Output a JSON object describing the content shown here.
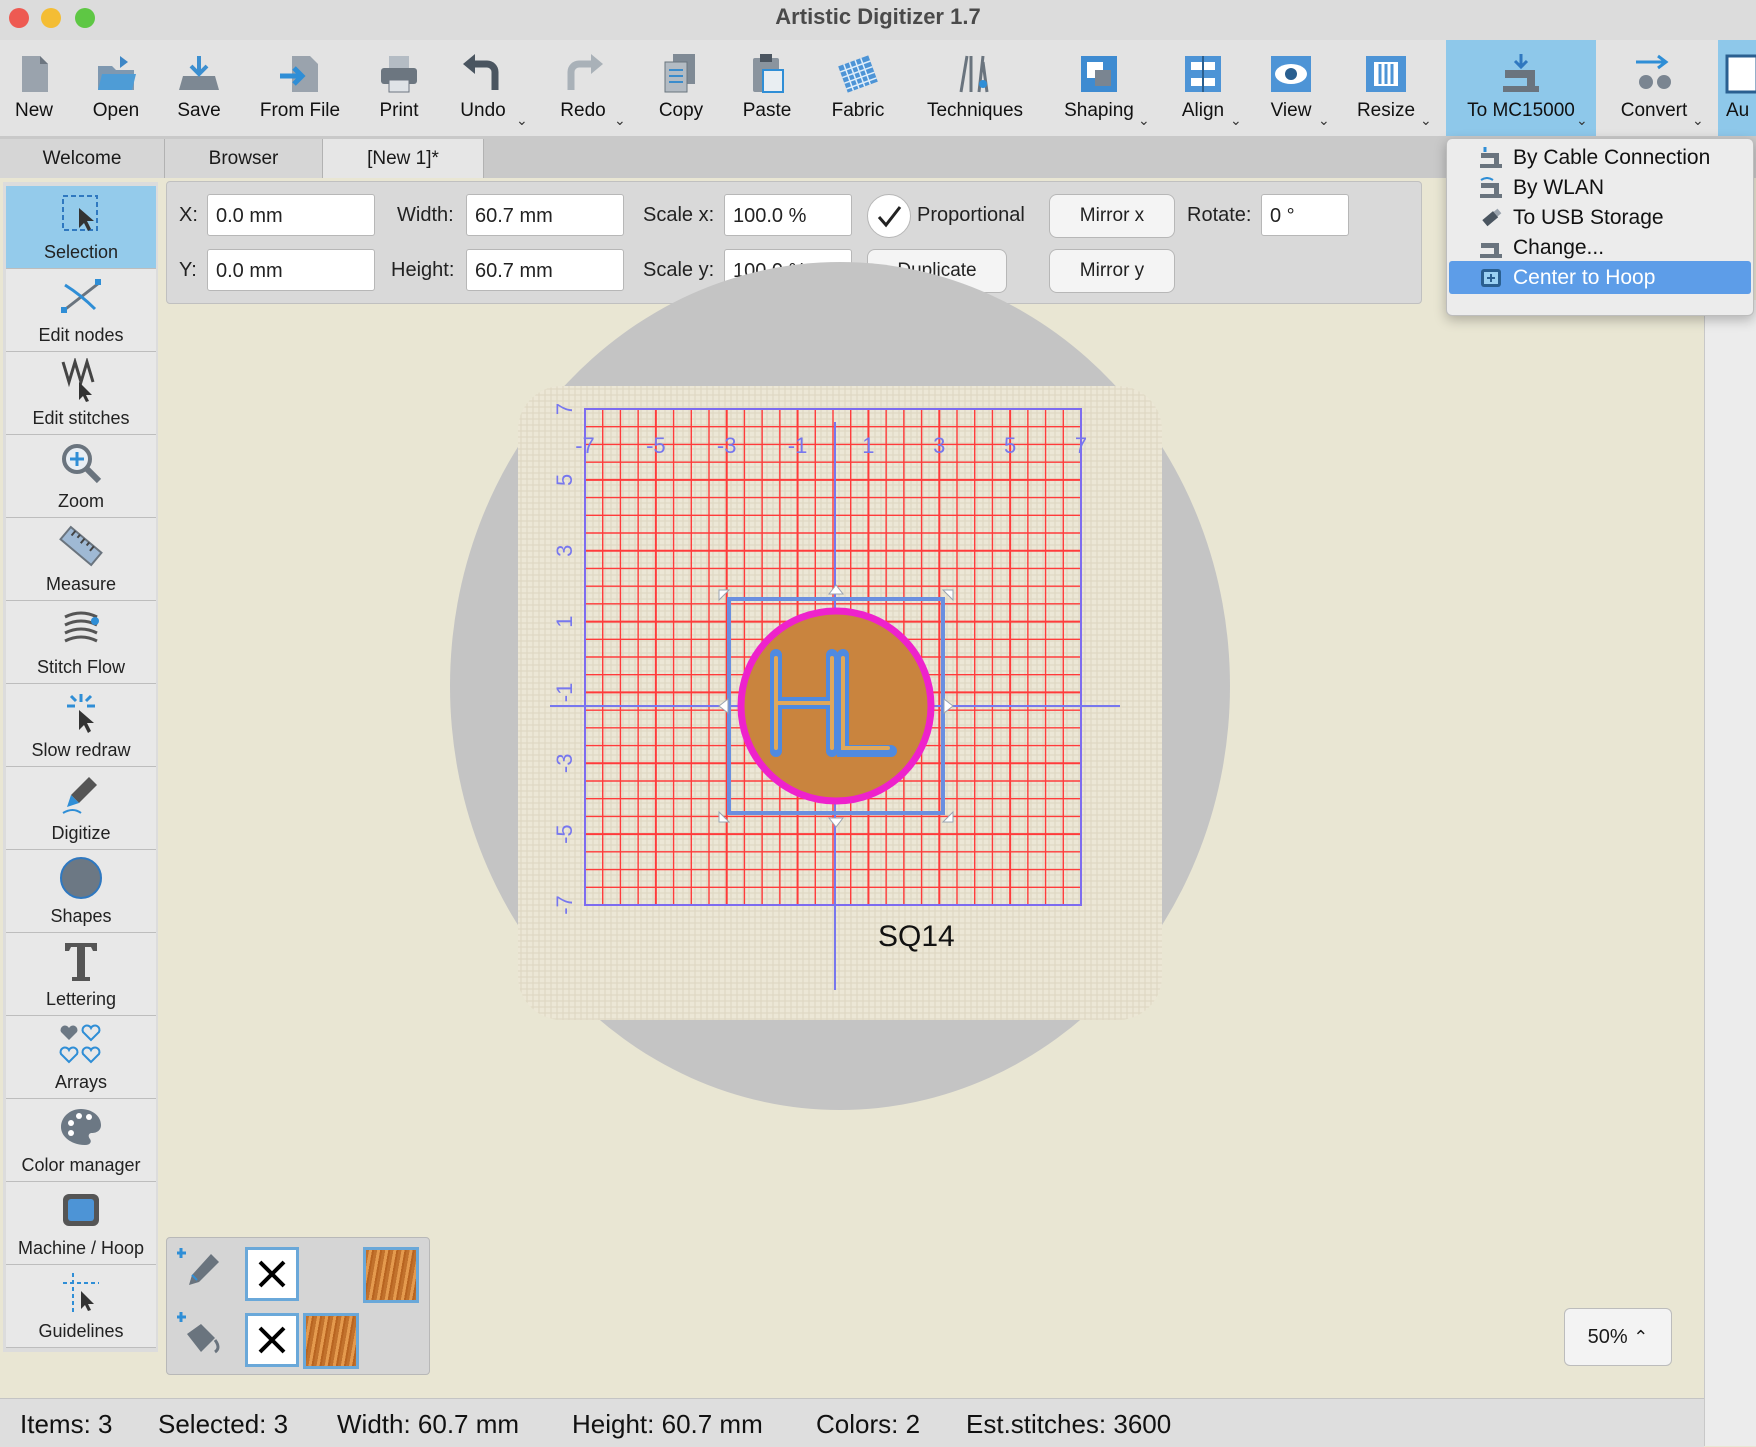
{
  "window": {
    "title": "Artistic Digitizer 1.7"
  },
  "toolbar": {
    "new": "New",
    "open": "Open",
    "save": "Save",
    "from_file": "From File",
    "print": "Print",
    "undo": "Undo",
    "redo": "Redo",
    "copy": "Copy",
    "paste": "Paste",
    "fabric": "Fabric",
    "techniques": "Techniques",
    "shaping": "Shaping",
    "align": "Align",
    "view": "View",
    "resize": "Resize",
    "to_machine": "To MC15000",
    "convert": "Convert",
    "auto": "Au"
  },
  "tabs": [
    {
      "label": "Welcome"
    },
    {
      "label": "Browser"
    },
    {
      "label": "[New 1]*"
    }
  ],
  "tools": [
    {
      "label": "Selection"
    },
    {
      "label": "Edit nodes"
    },
    {
      "label": "Edit stitches"
    },
    {
      "label": "Zoom"
    },
    {
      "label": "Measure"
    },
    {
      "label": "Stitch Flow"
    },
    {
      "label": "Slow redraw"
    },
    {
      "label": "Digitize"
    },
    {
      "label": "Shapes"
    },
    {
      "label": "Lettering"
    },
    {
      "label": "Arrays"
    },
    {
      "label": "Color manager"
    },
    {
      "label": "Machine / Hoop"
    },
    {
      "label": "Guidelines"
    }
  ],
  "props": {
    "x_label": "X:",
    "x_value": "0.0 mm",
    "y_label": "Y:",
    "y_value": "0.0 mm",
    "width_label": "Width:",
    "width_value": "60.7 mm",
    "height_label": "Height:",
    "height_value": "60.7 mm",
    "scalex_label": "Scale x:",
    "scalex_value": "100.0 %",
    "scaley_label": "Scale y:",
    "scaley_value": "100.0 %",
    "proportional_label": "Proportional",
    "proportional_checked": true,
    "duplicate": "Duplicate",
    "mirror_x": "Mirror x",
    "mirror_y": "Mirror y",
    "rotate_label": "Rotate:",
    "rotate_value": "0 °"
  },
  "dropdown": {
    "items": [
      {
        "label": "By Cable Connection",
        "icon": "machine-cable-icon"
      },
      {
        "label": "By WLAN",
        "icon": "machine-wlan-icon"
      },
      {
        "label": "To USB Storage",
        "icon": "usb-icon"
      },
      {
        "label": "Change...",
        "icon": "machine-icon"
      },
      {
        "label": "Center to Hoop",
        "icon": "center-hoop-icon",
        "highlighted": true
      }
    ]
  },
  "canvas": {
    "hoop_name": "SQ14",
    "design_text": "HL",
    "x_ticks": [
      "-7",
      "-5",
      "-3",
      "-1",
      "1",
      "3",
      "5",
      "7"
    ],
    "y_ticks": [
      "7",
      "5",
      "3",
      "1",
      "-1",
      "-3",
      "-5",
      "-7"
    ]
  },
  "zoom": {
    "level": "50%"
  },
  "status": {
    "items": "Items: 3",
    "selected": "Selected: 3",
    "width": "Width: 60.7 mm",
    "height": "Height: 60.7 mm",
    "colors": "Colors: 2",
    "stitches": "Est.stitches: 3600"
  }
}
